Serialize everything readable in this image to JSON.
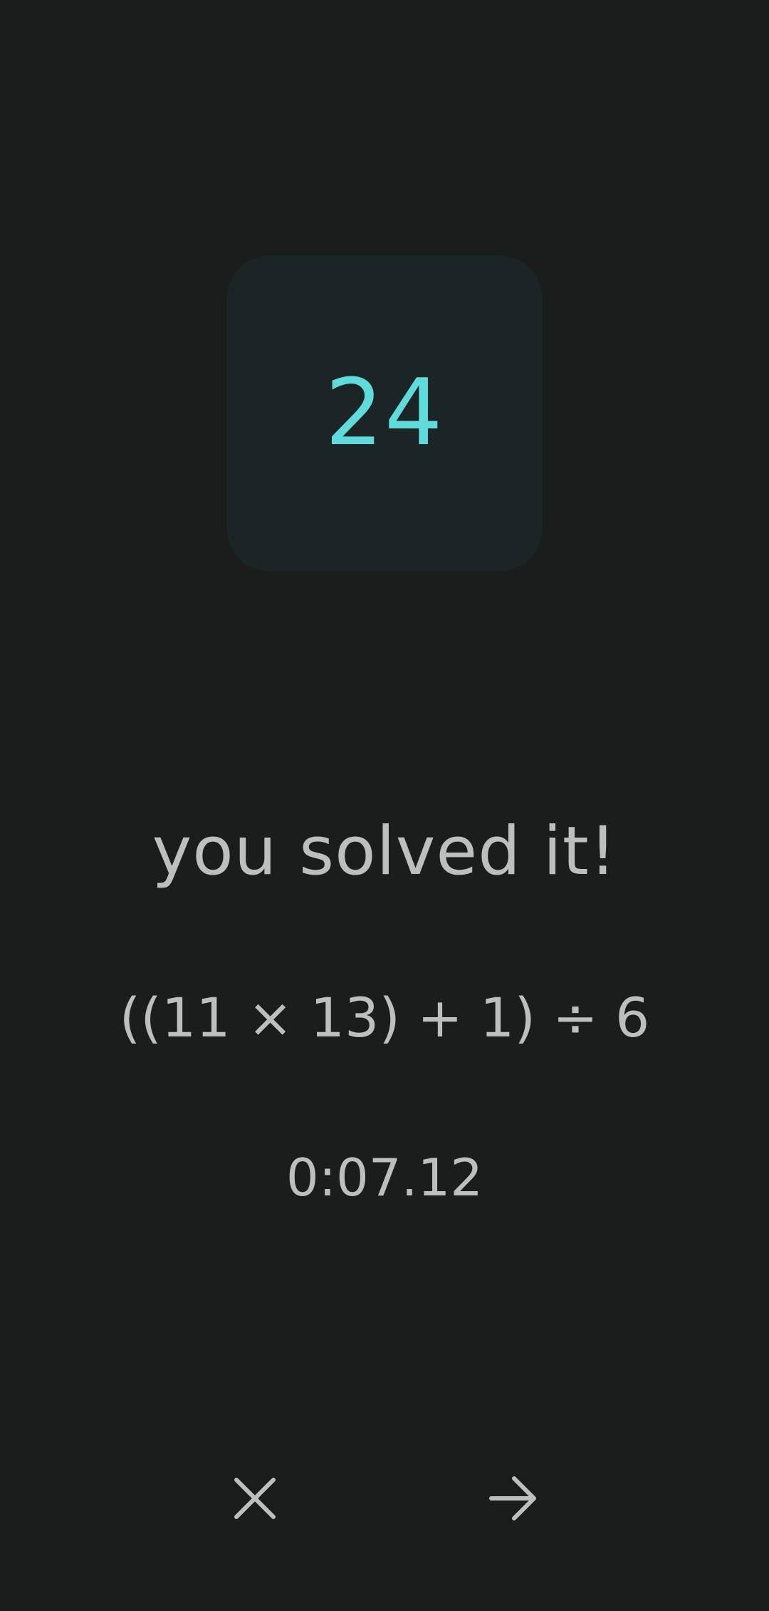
{
  "puzzle": {
    "target": "24"
  },
  "result": {
    "message": "you solved it!",
    "expression": "((11 × 13) + 1) ÷ 6",
    "time": "0:07.12"
  },
  "actions": {
    "close_icon": "close-icon",
    "next_icon": "arrow-right-icon"
  },
  "colors": {
    "background": "#1b1c1c",
    "tile": "#1b2526",
    "accent": "#5fdbdb",
    "text": "#bdbfbe"
  }
}
